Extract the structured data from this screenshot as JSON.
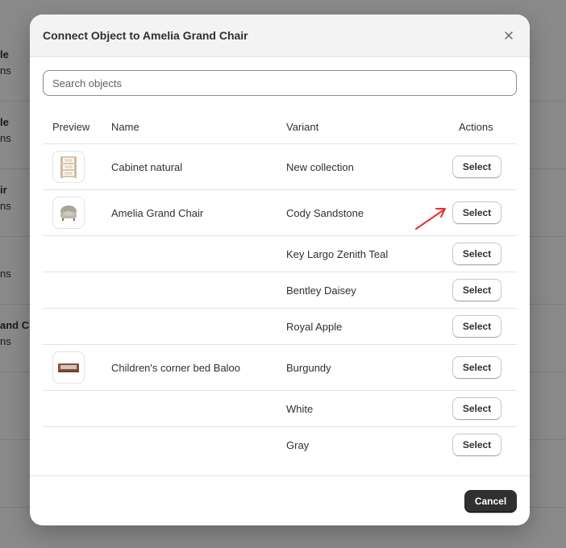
{
  "background": {
    "rows": [
      {
        "title": "le",
        "subtitle": "ns"
      },
      {
        "title": "le",
        "subtitle": "ns"
      },
      {
        "title": "ir",
        "subtitle": "ns"
      },
      {
        "title": "",
        "subtitle": "ns"
      },
      {
        "title": "and Cl",
        "subtitle": "ns"
      }
    ]
  },
  "modal": {
    "title": "Connect Object to Amelia Grand Chair",
    "close_icon": "close-icon"
  },
  "search": {
    "placeholder": "Search objects",
    "value": ""
  },
  "table": {
    "headers": {
      "preview": "Preview",
      "name": "Name",
      "variant": "Variant",
      "actions": "Actions"
    },
    "rows": [
      {
        "thumbnail": "cabinet-thumbnail",
        "name": "Cabinet natural",
        "variant": "New collection",
        "action": "Select"
      },
      {
        "thumbnail": "chair-thumbnail",
        "name": "Amelia Grand Chair",
        "variant": "Cody Sandstone",
        "action": "Select"
      },
      {
        "thumbnail": "",
        "name": "",
        "variant": "Key Largo Zenith Teal",
        "action": "Select"
      },
      {
        "thumbnail": "",
        "name": "",
        "variant": "Bentley Daisey",
        "action": "Select"
      },
      {
        "thumbnail": "",
        "name": "",
        "variant": "Royal Apple",
        "action": "Select"
      },
      {
        "thumbnail": "bed-thumbnail",
        "name": "Children's corner bed Baloo",
        "variant": "Burgundy",
        "action": "Select"
      },
      {
        "thumbnail": "",
        "name": "",
        "variant": "White",
        "action": "Select"
      },
      {
        "thumbnail": "",
        "name": "",
        "variant": "Gray",
        "action": "Select"
      }
    ]
  },
  "footer": {
    "cancel_label": "Cancel"
  },
  "annotation": {
    "arrow_icon": "red-arrow-icon",
    "color": "#e8312f"
  },
  "colors": {
    "primary_button": "#303030",
    "overlay": "#8a8a8a"
  }
}
